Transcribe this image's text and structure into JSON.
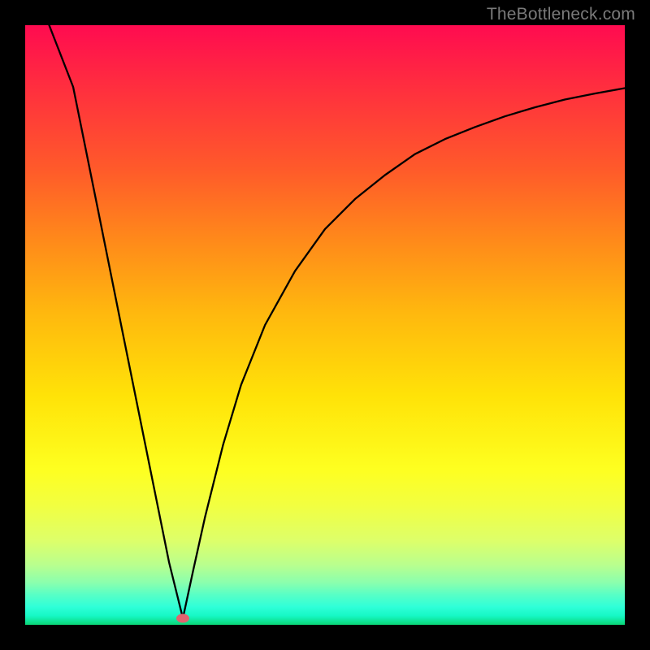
{
  "watermark": "TheBottleneck.com",
  "marker": {
    "x_pct": 26.3,
    "y_pct": 98.9
  },
  "chart_data": {
    "type": "line",
    "title": "",
    "xlabel": "",
    "ylabel": "",
    "xlim": [
      0,
      100
    ],
    "ylim": [
      0,
      100
    ],
    "grid": false,
    "legend": false,
    "annotations": {
      "watermark": "TheBottleneck.com",
      "minimum_marker": {
        "x": 26.3,
        "y": 1.1
      }
    },
    "series": [
      {
        "name": "left-branch",
        "x": [
          4.0,
          8.0,
          12.0,
          16.0,
          20.0,
          24.0,
          26.3
        ],
        "y": [
          100.0,
          89.7,
          69.9,
          50.0,
          30.2,
          10.4,
          1.1
        ],
        "note": "approximately linear descending segment; extrapolates above 100 at x<4"
      },
      {
        "name": "right-branch",
        "x": [
          26.3,
          28,
          30,
          33,
          36,
          40,
          45,
          50,
          55,
          60,
          65,
          70,
          75,
          80,
          85,
          90,
          95,
          100
        ],
        "y": [
          1.1,
          9,
          18,
          30,
          40,
          50,
          59,
          66,
          71,
          75,
          78.5,
          81,
          83,
          84.8,
          86.3,
          87.6,
          88.6,
          89.5
        ],
        "note": "concave ascending segment approaching ~90 asymptotically"
      }
    ],
    "background_gradient": {
      "orientation": "vertical",
      "stops": [
        {
          "pos": 0.0,
          "color": "#ff0b50"
        },
        {
          "pos": 0.1,
          "color": "#ff2d3f"
        },
        {
          "pos": 0.24,
          "color": "#ff5a2a"
        },
        {
          "pos": 0.36,
          "color": "#ff8a1a"
        },
        {
          "pos": 0.48,
          "color": "#ffb80e"
        },
        {
          "pos": 0.62,
          "color": "#ffe308"
        },
        {
          "pos": 0.74,
          "color": "#feff20"
        },
        {
          "pos": 0.8,
          "color": "#f2ff40"
        },
        {
          "pos": 0.86,
          "color": "#ddff6a"
        },
        {
          "pos": 0.9,
          "color": "#b9ff8e"
        },
        {
          "pos": 0.93,
          "color": "#8affae"
        },
        {
          "pos": 0.95,
          "color": "#57ffc6"
        },
        {
          "pos": 0.97,
          "color": "#2fffd8"
        },
        {
          "pos": 0.985,
          "color": "#16f8c5"
        },
        {
          "pos": 1.0,
          "color": "#0bd676"
        }
      ]
    }
  }
}
